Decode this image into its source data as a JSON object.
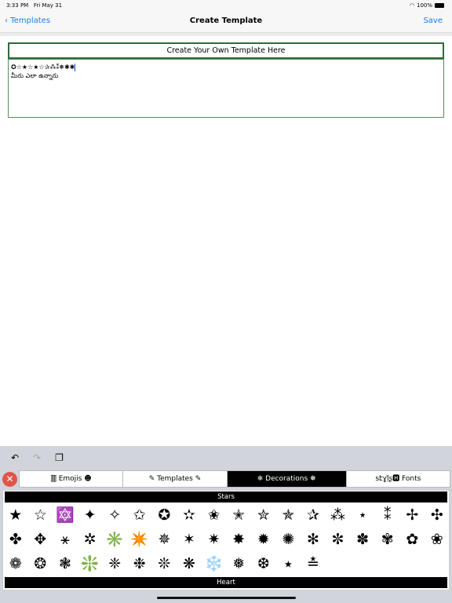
{
  "status": {
    "time": "3:33 PM",
    "date": "Fri May 31",
    "battery": "100%"
  },
  "nav": {
    "back": "Templates",
    "title": "Create Template",
    "save": "Save"
  },
  "editor": {
    "heading": "Create Your Own Template Here",
    "line1": "✪☆★☆★☆✰⁂⁑❅✱✱",
    "line2": "మీరు ఎలా ఉన్నారు"
  },
  "toolbar": {
    "undo": "↶",
    "redo": "↷",
    "paste": "❐"
  },
  "tabs": [
    {
      "label": "🀫 Emojis ☻"
    },
    {
      "label": "✎ Templates ✎"
    },
    {
      "label": "❄ Decorations ❅"
    },
    {
      "label": "sէɣļ̃ʂ🅷 Fonts"
    }
  ],
  "active_tab": "Decorations",
  "sections": {
    "stars": "Stars",
    "heart": "Heart"
  },
  "stars": [
    "★",
    "☆",
    "🔯",
    "✦",
    "✧",
    "✩",
    "✪",
    "✫",
    "✬",
    "✭",
    "✮",
    "✯",
    "✰",
    "⁂",
    "⋆",
    "⁑",
    "✢",
    "✣",
    "✤",
    "✥",
    "⚹",
    "✲",
    "✳️",
    "✴️",
    "✵",
    "✶",
    "✷",
    "✸",
    "✹",
    "✺",
    "✻",
    "✼",
    "✽",
    "✾",
    "✿",
    "❀",
    "❁",
    "❂",
    "❃",
    "❇️",
    "❈",
    "❉",
    "❊",
    "❋",
    "❄️",
    "❅",
    "❆",
    "⭑",
    "≛"
  ]
}
